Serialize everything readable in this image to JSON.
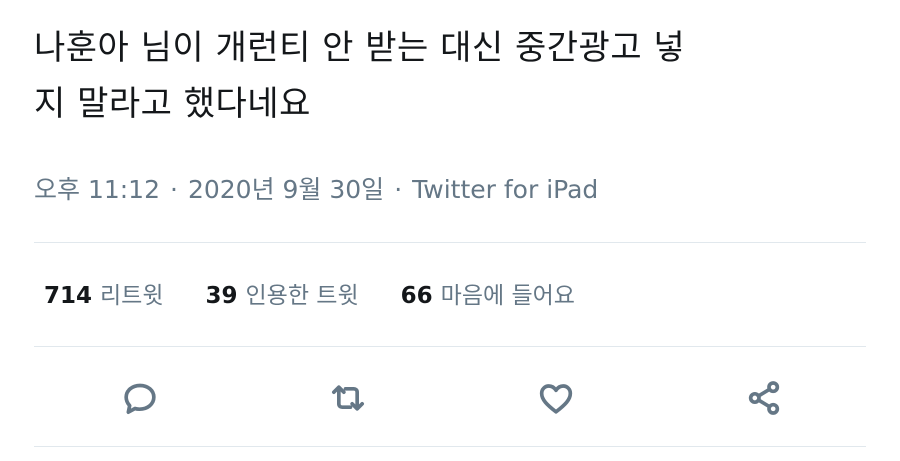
{
  "tweet": {
    "text": "나훈아 님이 개런티 안 받는 대신 중간광고 넣\n지 말라고 했다네요"
  },
  "meta": {
    "time": "오후 11:12",
    "date": "2020년 9월 30일",
    "source": "Twitter for iPad",
    "separator": "·"
  },
  "stats": {
    "retweets": {
      "count": "714",
      "label": "리트윗"
    },
    "quotes": {
      "count": "39",
      "label": "인용한 트윗"
    },
    "likes": {
      "count": "66",
      "label": "마음에 들어요"
    }
  },
  "actions": [
    {
      "icon": "reply-icon"
    },
    {
      "icon": "retweet-icon"
    },
    {
      "icon": "like-icon"
    },
    {
      "icon": "share-icon"
    }
  ],
  "colors": {
    "text": "#14171a",
    "secondary": "#657786",
    "divider": "#e1e8ed"
  }
}
